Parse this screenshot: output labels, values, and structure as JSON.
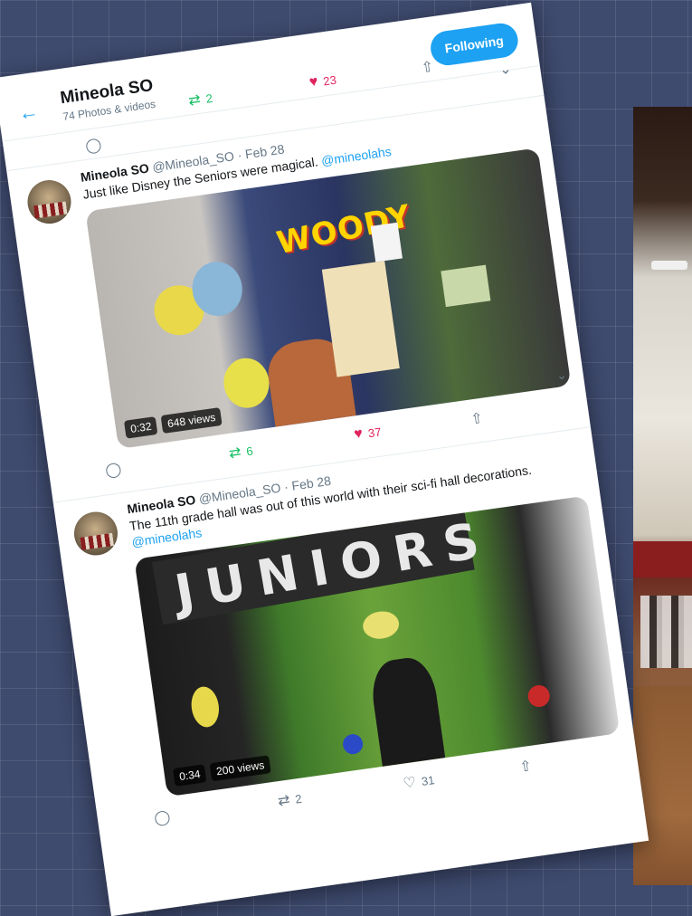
{
  "profile": {
    "name": "Mineola SO",
    "subtitle": "74 Photos & videos",
    "follow_label": "Following"
  },
  "top_actions": {
    "retweets": "2",
    "likes": "23"
  },
  "tweets": [
    {
      "name": "Mineola SO",
      "handle": "@Mineola_SO · Feb 28",
      "text": "Just like Disney the Seniors were magical.",
      "mention": "@mineolahs",
      "media_sign": "WOODY",
      "duration": "0:32",
      "views": "648 views",
      "retweets": "6",
      "likes": "37"
    },
    {
      "name": "Mineola SO",
      "handle": "@Mineola_SO · Feb 28",
      "text": "The 11th grade hall was out of this world with their sci-fi hall decorations.",
      "mention": "@mineolahs",
      "media_sign": "JUNIORS",
      "duration": "0:34",
      "views": "200 views",
      "retweets": "2",
      "likes": "31"
    }
  ],
  "icons": {
    "back": "arrow-left-icon",
    "reply": "speech-bubble-icon",
    "retweet": "retweet-icon",
    "like": "heart-icon",
    "share": "share-icon",
    "more": "chevron-down-icon"
  },
  "colors": {
    "accent": "#1da1f2",
    "like": "#e0245e",
    "retweet": "#17bf63"
  }
}
